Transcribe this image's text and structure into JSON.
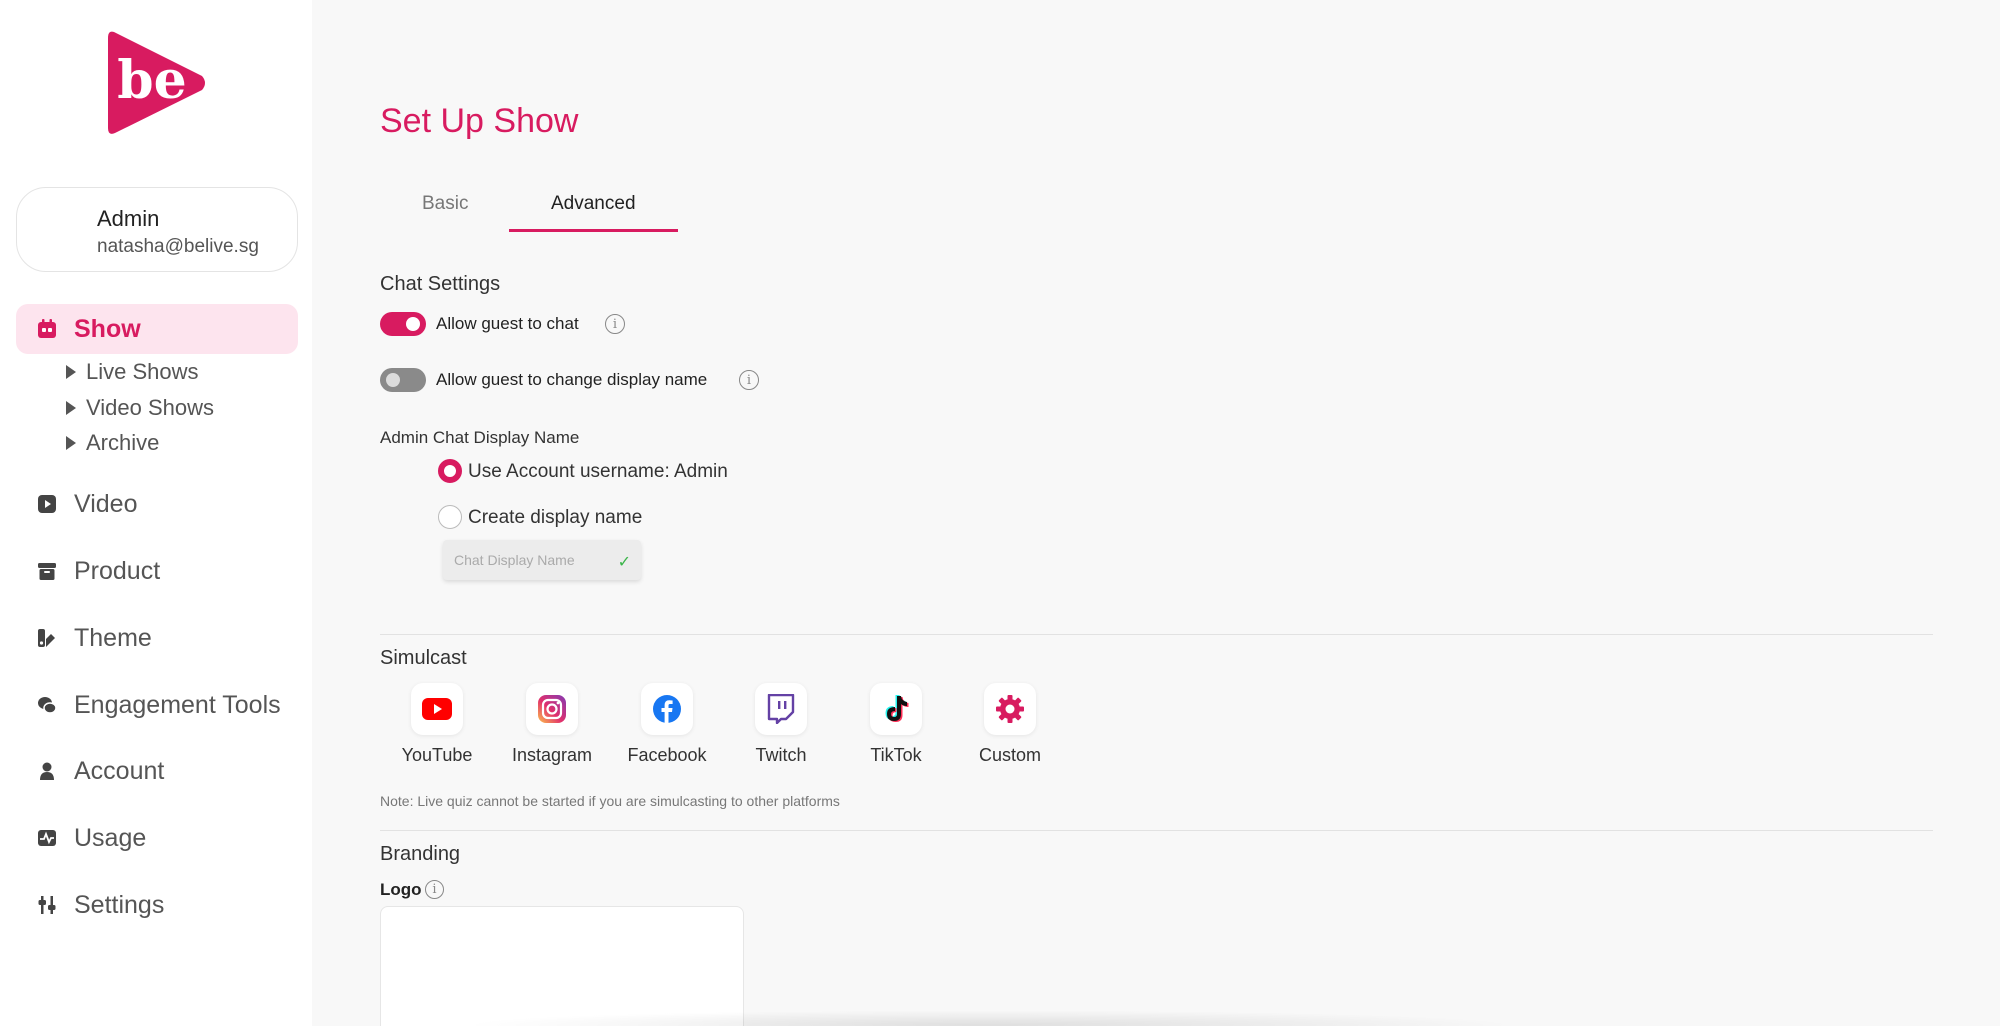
{
  "user": {
    "name": "Admin",
    "email": "natasha@belive.sg"
  },
  "sidebar": {
    "show_label": "Show",
    "sub_items": [
      "Live Shows",
      "Video Shows",
      "Archive"
    ],
    "items": [
      "Video",
      "Product",
      "Theme",
      "Engagement Tools",
      "Account",
      "Usage",
      "Settings"
    ]
  },
  "page": {
    "title": "Set Up Show"
  },
  "tabs": {
    "basic": "Basic",
    "advanced": "Advanced",
    "active": "Advanced"
  },
  "chat": {
    "section_title": "Chat Settings",
    "allow_guest_chat": {
      "label": "Allow guest to chat",
      "enabled": true
    },
    "allow_guest_rename": {
      "label": "Allow guest to change display name",
      "enabled": false
    },
    "admin_display_title": "Admin Chat Display Name",
    "option_account": "Use Account username: Admin",
    "option_custom": "Create display name",
    "selected_option": "account",
    "display_name_placeholder": "Chat Display Name"
  },
  "simulcast": {
    "title": "Simulcast",
    "platforms": [
      "YouTube",
      "Instagram",
      "Facebook",
      "Twitch",
      "TikTok",
      "Custom"
    ],
    "note": "Note: Live quiz cannot be started if you are simulcasting to other platforms"
  },
  "branding": {
    "title": "Branding",
    "logo_label": "Logo"
  },
  "colors": {
    "accent": "#d81b60",
    "active_bg": "#fde4ee",
    "toggle_off": "#8a8a8a"
  },
  "logo_text": "be"
}
